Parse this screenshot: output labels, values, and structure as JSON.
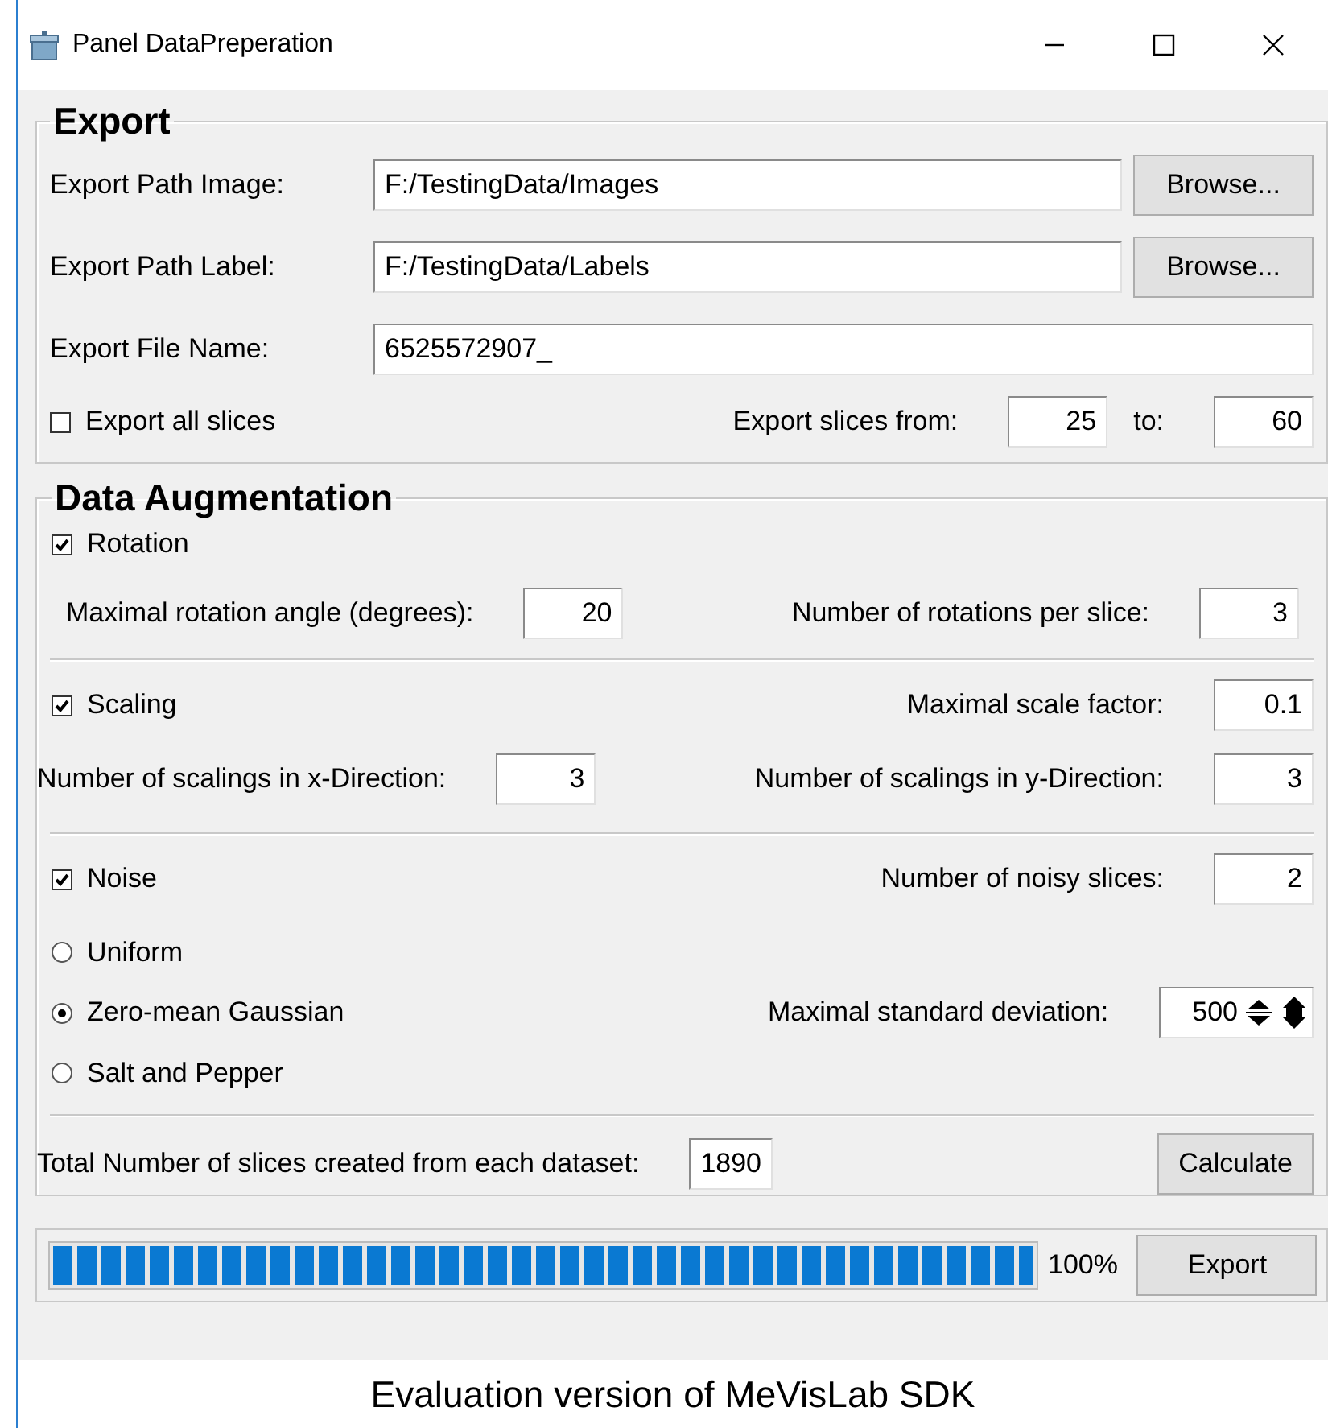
{
  "window": {
    "title": "Panel DataPreperation"
  },
  "export": {
    "title": "Export",
    "path_fields": [
      {
        "label": "Export Path Image:",
        "value": "F:/TestingData/Images",
        "button": "Browse..."
      },
      {
        "label": "Export Path Label:",
        "value": "F:/TestingData/Labels",
        "button": "Browse..."
      }
    ],
    "file_name": {
      "label": "Export File Name:",
      "value": "6525572907_"
    },
    "export_all_slices": {
      "label": "Export all slices",
      "checked": false
    },
    "slices_from": {
      "label": "Export slices from:",
      "value": "25"
    },
    "slices_to": {
      "label": "to:",
      "value": "60"
    }
  },
  "augmentation": {
    "title": "Data Augmentation",
    "rotation": {
      "label": "Rotation",
      "checked": true,
      "angle": {
        "label": "Maximal rotation angle (degrees):",
        "value": "20"
      },
      "per_slice": {
        "label": "Number of rotations per slice:",
        "value": "3"
      }
    },
    "scaling": {
      "label": "Scaling",
      "checked": true,
      "factor": {
        "label": "Maximal scale factor:",
        "value": "0.1"
      },
      "x_direction": {
        "label": "Number of scalings in x-Direction:",
        "value": "3"
      },
      "y_direction": {
        "label": "Number of scalings in y-Direction:",
        "value": "3"
      }
    },
    "noise": {
      "label": "Noise",
      "checked": true,
      "noisy_slices": {
        "label": "Number of noisy slices:",
        "value": "2"
      },
      "types": [
        {
          "label": "Uniform",
          "selected": false
        },
        {
          "label": "Zero-mean Gaussian",
          "selected": true
        },
        {
          "label": "Salt and Pepper",
          "selected": false
        }
      ],
      "std_deviation": {
        "label": "Maximal standard deviation:",
        "value": "500"
      }
    },
    "total": {
      "label": "Total Number of slices created from each dataset:",
      "value": "1890",
      "button": "Calculate"
    }
  },
  "progress": {
    "level": 1,
    "reading": "100%",
    "button": "Export"
  },
  "footer": "Evaluation version of MeVisLab SDK"
}
